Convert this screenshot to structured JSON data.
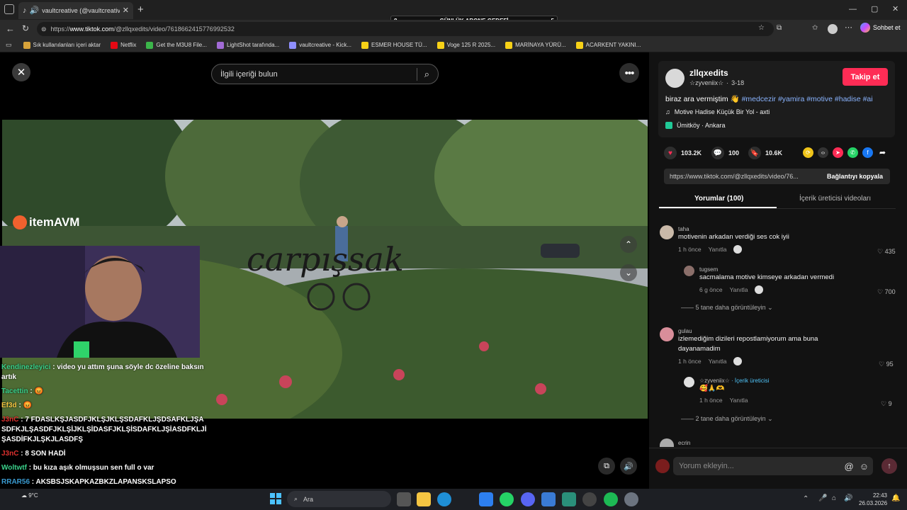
{
  "browser": {
    "tab_title": "vaultcreative (@vaultcreative)",
    "url_prefix": "https://",
    "url_host": "www.tiktok.com",
    "url_path": "/@zllqxedits/video/7618662415776992532",
    "copilot_label": "Sohbet et",
    "bookmarks": [
      {
        "label": "Sık kullanılanları içeri aktar",
        "color": "#d8a33a"
      },
      {
        "label": "Netflix",
        "color": "#e50914"
      },
      {
        "label": "Get the M3U8 File...",
        "color": "#3bb54a"
      },
      {
        "label": "LightShot tarafında...",
        "color": "#a26bd6"
      },
      {
        "label": "vaultcreative - Kick...",
        "color": "#8f8fff"
      },
      {
        "label": "ESMER HOUSE TÜ...",
        "color": "#f7d117"
      },
      {
        "label": "Voge 125 R 2025...",
        "color": "#f7d117"
      },
      {
        "label": "MARİNAYA YÜRÜ...",
        "color": "#f7d117"
      },
      {
        "label": "ACARKENT YAKINI...",
        "color": "#f7d117"
      }
    ]
  },
  "overlay": {
    "goal_left": "8",
    "goal_label": "GÜNLÜK ABONE GEDEFİ",
    "goal_right": "5",
    "brand_logo": "itemAVM",
    "watermark": "carpışsak"
  },
  "video": {
    "search_placeholder": "İlgili içeriği bulun"
  },
  "chat": [
    {
      "user": "Kendinezleyici",
      "user_color": "#3ad18a",
      "text": ": video yu attım şuna söyle dc özeline baksın artık"
    },
    {
      "user": "Tacettin",
      "user_color": "#3ad18a",
      "text": ": 😡"
    },
    {
      "user": "Ef3d",
      "user_color": "#f4c542",
      "text": ": 😡"
    },
    {
      "user": "J3nC",
      "user_color": "#e0312f",
      "text": ": 7 FDASLKŞJASDFJKLŞJKLŞSDAFKLJŞDSAFKLJŞASDFKJLŞASDFJKLŞİJKLŞİDASFJKLŞİSDAFKLJŞİASDFKLJİŞASDİFKJLŞKJLASDFŞ"
    },
    {
      "user": "J3nC",
      "user_color": "#e0312f",
      "text": ": 8 SON HADİ"
    },
    {
      "user": "Woltwtf",
      "user_color": "#3ad18a",
      "text": ": bu kıza aşık olmuşsun sen full o var"
    },
    {
      "user": "RRAR56",
      "user_color": "#3a9bd1",
      "text": ": AKSBSJSKAPKAZBKZLAPANSKSLAPSO"
    }
  ],
  "post": {
    "username": "zllqxedits",
    "nickname": "☆zyveniix☆",
    "date": "3-18",
    "follow_label": "Takip et",
    "caption_text": "biraz ara vermiştim 👋",
    "hashtags": "#medcezir #yamira #motive #hadise #ai",
    "music": "Motive Hadise Küçük Bir Yol - axti",
    "location": "Ümitköy · Ankara",
    "likes": "103.2K",
    "comments": "100",
    "saves": "10.6K",
    "share_url": "https://www.tiktok.com/@zllqxedits/video/76...",
    "copy_label": "Bağlantıyı kopyala",
    "tab_comments": "Yorumlar (100)",
    "tab_videos": "İçerik üreticisi videoları"
  },
  "comments": [
    {
      "user": "taha",
      "text": "motivenin arkadan verdiği ses cok iyii",
      "time": "1 h önce",
      "reply": "Yanıtla",
      "likes": "435"
    },
    {
      "user": "tugsem",
      "text": "sacmalama motive kimseye arkadan vermedi",
      "time": "6 g önce",
      "reply": "Yanıtla",
      "likes": "700"
    },
    {
      "more": "5 tane daha görüntüleyin"
    },
    {
      "user": "gulau",
      "text": "izlemediğim dizileri repostlamiyorum ama buna dayanamadim",
      "time": "1 h önce",
      "reply": "Yanıtla",
      "likes": "95"
    },
    {
      "user": "☆zyveniix☆",
      "creator_badge": "· İçerik üreticisi",
      "text": "🥰🙏🫶",
      "time": "1 h önce",
      "reply": "Yanıtla",
      "likes": "9"
    },
    {
      "more": "2 tane daha görüntüleyin"
    },
    {
      "user": "ecrin"
    }
  ],
  "comment_input_placeholder": "Yorum ekleyin...",
  "taskbar": {
    "weather_temp": "9°C",
    "search_label": "Ara",
    "time": "22:43",
    "date": "26.03.2026"
  }
}
